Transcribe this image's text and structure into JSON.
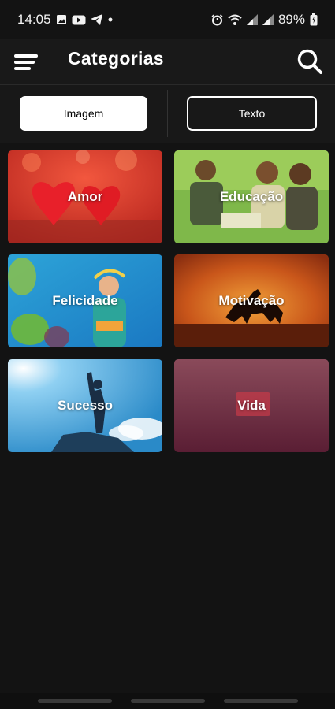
{
  "status": {
    "time": "14:05",
    "battery": "89%",
    "icons": [
      "gallery-icon",
      "youtube-icon",
      "telegram-icon",
      "dot-icon",
      "alarm-icon",
      "wifi-icon",
      "signal-icon",
      "signal-icon-2",
      "battery-icon"
    ]
  },
  "appbar": {
    "title": "Categorias",
    "menu_icon": "hamburger-menu-icon",
    "search_icon": "search-icon"
  },
  "toggle": {
    "image_label": "Imagem",
    "text_label": "Texto",
    "selected": "Imagem"
  },
  "categories": [
    {
      "label": "Amor"
    },
    {
      "label": "Educação"
    },
    {
      "label": "Felicidade"
    },
    {
      "label": "Motivação"
    },
    {
      "label": "Sucesso"
    },
    {
      "label": "Vida"
    }
  ],
  "colors": {
    "background": "#131313",
    "appbar": "#191919",
    "tab_selected_bg": "#ffffff",
    "tab_outline": "#ffffff"
  }
}
